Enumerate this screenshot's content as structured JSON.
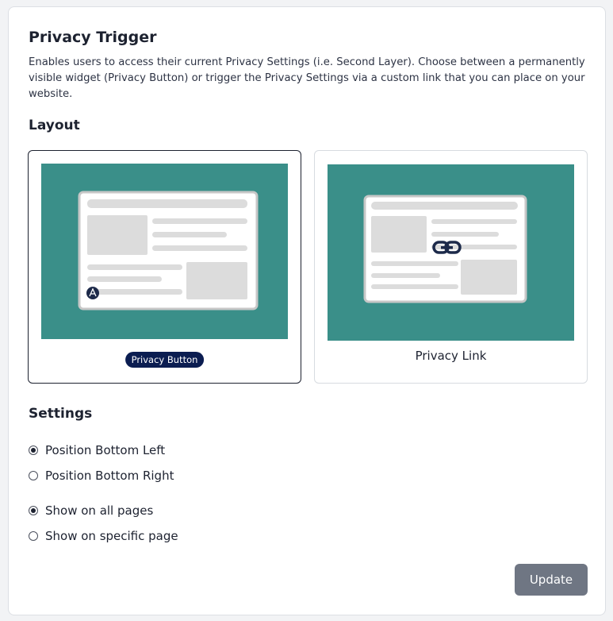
{
  "header": {
    "title": "Privacy Trigger",
    "description": "Enables users to access their current Privacy Settings (i.e. Second Layer). Choose between a permanently visible widget (Privacy Button) or trigger the Privacy Settings via a custom link that you can place on your website."
  },
  "layout": {
    "title": "Layout",
    "options": [
      {
        "label": "Privacy Button",
        "selected": true
      },
      {
        "label": "Privacy Link",
        "selected": false
      }
    ]
  },
  "settings": {
    "title": "Settings",
    "position": [
      {
        "label": "Position Bottom Left",
        "checked": true
      },
      {
        "label": "Position Bottom Right",
        "checked": false
      }
    ],
    "pages": [
      {
        "label": "Show on all pages",
        "checked": true
      },
      {
        "label": "Show on specific page",
        "checked": false
      }
    ]
  },
  "actions": {
    "update_label": "Update"
  },
  "colors": {
    "teal": "#3a8f89",
    "navy": "#0b1d51",
    "placeholder": "#dcdcdc",
    "button_gray": "#6f7683"
  }
}
